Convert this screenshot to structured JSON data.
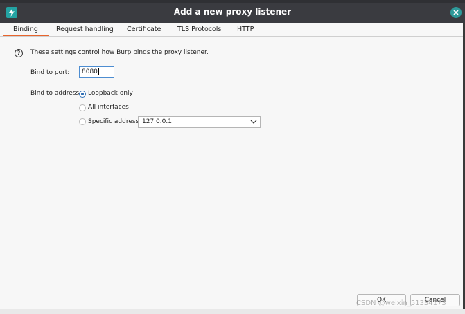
{
  "window": {
    "title": "Add a new proxy listener",
    "colors": {
      "titlebar": "#3a3b40",
      "accent_tab": "#e8642c",
      "app_icon": "#23a3a3",
      "focus": "#4d8dd1"
    }
  },
  "tabs": [
    {
      "label": "Binding",
      "active": true
    },
    {
      "label": "Request handling",
      "active": false
    },
    {
      "label": "Certificate",
      "active": false
    },
    {
      "label": "TLS Protocols",
      "active": false
    },
    {
      "label": "HTTP",
      "active": false
    }
  ],
  "binding": {
    "info_text": "These settings control how Burp binds the proxy listener.",
    "port_label": "Bind to port:",
    "port_value": "8080",
    "address_label": "Bind to address:",
    "address_options": [
      {
        "label": "Loopback only",
        "selected": true
      },
      {
        "label": "All interfaces",
        "selected": false
      },
      {
        "label": "Specific address:",
        "selected": false
      }
    ],
    "specific_address_value": "127.0.0.1"
  },
  "footer": {
    "ok_label": "OK",
    "cancel_label": "Cancel"
  },
  "watermark": "CSDN @weixin_51334173"
}
